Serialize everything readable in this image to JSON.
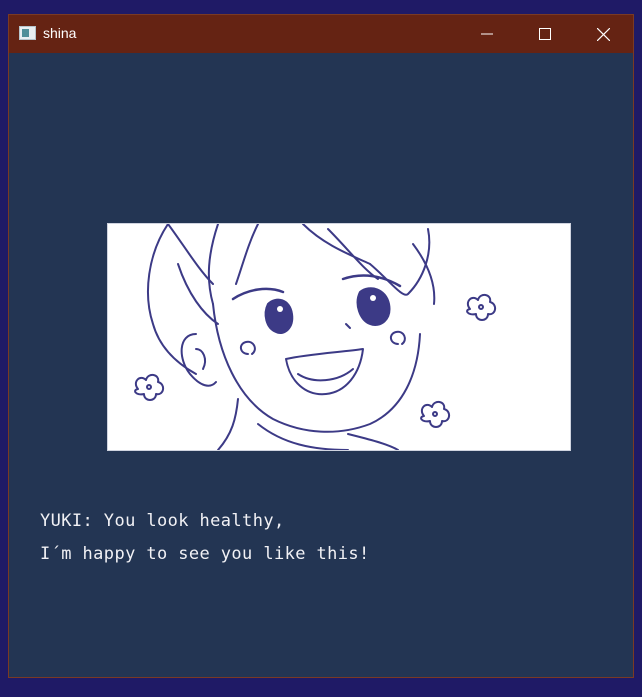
{
  "window": {
    "title": "shina",
    "app_icon": "window-app-icon",
    "controls": [
      {
        "name": "minimize",
        "icon": "minimize-icon"
      },
      {
        "name": "maximize",
        "icon": "maximize-icon"
      },
      {
        "name": "close",
        "icon": "close-icon"
      }
    ]
  },
  "scene": {
    "illustration": "smiling-boy-portrait",
    "line_color": "#3c3a86"
  },
  "dialogue": {
    "line1": "YUKI: You look healthy,",
    "line2": "I´m happy to see you like this!"
  },
  "colors": {
    "titlebar": "#652313",
    "window_bg": "#233553",
    "desktop": "#1f1a66",
    "text": "#f1f1f5"
  }
}
